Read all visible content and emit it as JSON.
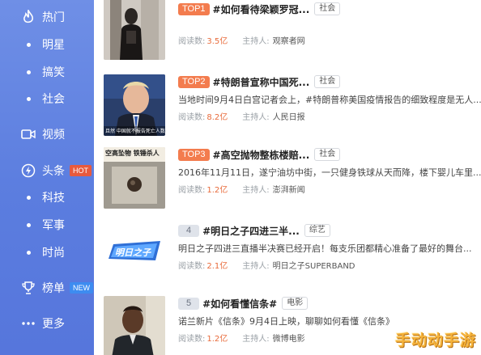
{
  "sidebar": {
    "items": [
      {
        "label": "热门",
        "icon": "fire-icon"
      },
      {
        "label": "明星"
      },
      {
        "label": "搞笑"
      },
      {
        "label": "社会"
      },
      {
        "label": "视频",
        "icon": "video-icon"
      },
      {
        "label": "头条",
        "icon": "lightning-icon",
        "badge": "HOT"
      },
      {
        "label": "科技"
      },
      {
        "label": "军事"
      },
      {
        "label": "时尚"
      },
      {
        "label": "榜单",
        "icon": "trophy-icon",
        "badge": "NEW"
      },
      {
        "label": "更多",
        "icon": "more-icon"
      }
    ]
  },
  "list": {
    "read_label": "阅读数:",
    "host_label": "主持人:",
    "items": [
      {
        "rank": "TOP1",
        "title": "#如何看待梁颖罗冠...",
        "tag": "社会",
        "desc": "",
        "reads": "3.5亿",
        "host": "观察者网"
      },
      {
        "rank": "TOP2",
        "title": "#特朗普宣称中国死...",
        "tag": "社会",
        "desc": "当地时间9月4日白宫记者会上，#特朗普称美国疫情报告的细致程度是无人...",
        "reads": "8.2亿",
        "host": "人民日报",
        "thumb_caption": "且然 中国就不报告死亡人数"
      },
      {
        "rank": "TOP3",
        "title": "#高空抛物整栋楼赔...",
        "tag": "社会",
        "desc": "2016年11月11日，遂宁油坊中街，一只健身铁球从天而降，楼下婴儿车里...",
        "reads": "1.2亿",
        "host": "澎湃新闻",
        "thumb_caption": "空高坠物  铁锤杀人"
      },
      {
        "rank": "4",
        "title": "#明日之子四进三半...",
        "tag": "综艺",
        "desc": "明日之子四进三直播半决赛已经开启！每支乐团都精心准备了最好的舞台...",
        "reads": "2.1亿",
        "host": "明日之子SUPERBAND"
      },
      {
        "rank": "5",
        "title": "#如何看懂信条#",
        "tag": "电影",
        "desc": "诺兰新片《信条》9月4日上映，聊聊如何看懂《信条》",
        "reads": "1.2亿",
        "host": "微博电影"
      }
    ]
  },
  "watermark": "手动动手游"
}
